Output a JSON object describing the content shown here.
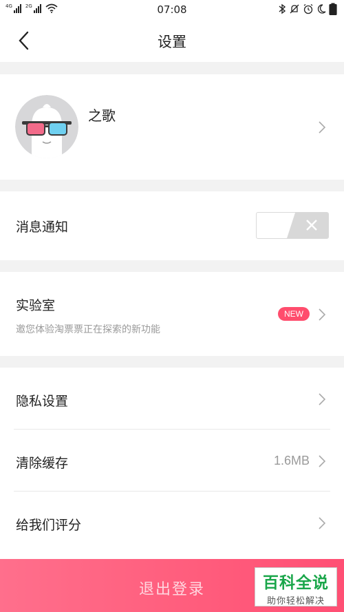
{
  "status_bar": {
    "sim1_tag": "4G",
    "sim2_tag": "2G",
    "time": "07:08",
    "icons": [
      "bluetooth-icon",
      "mute-icon",
      "alarm-icon",
      "moon-icon",
      "battery-icon"
    ]
  },
  "nav": {
    "title": "设置",
    "back_icon": "chevron-left-icon"
  },
  "profile": {
    "name": "之歌",
    "avatar_icon": "ghost-with-3d-glasses-avatar"
  },
  "notifications": {
    "label": "消息通知",
    "toggle_state": "off"
  },
  "lab": {
    "label": "实验室",
    "subtitle": "邀您体验淘票票正在探索的新功能",
    "badge": "NEW"
  },
  "settings_list": {
    "items": [
      {
        "label": "隐私设置",
        "value": ""
      },
      {
        "label": "清除缓存",
        "value": "1.6MB"
      },
      {
        "label": "给我们评分",
        "value": ""
      }
    ]
  },
  "logout": {
    "label": "退出登录"
  },
  "watermark": {
    "title": "百科全说",
    "subtitle": "助你轻松解决"
  },
  "colors": {
    "accent": "#ff5f7e",
    "badge": "#ff4d6d",
    "background": "#f2f2f2",
    "watermark_green": "#1aa64a"
  }
}
